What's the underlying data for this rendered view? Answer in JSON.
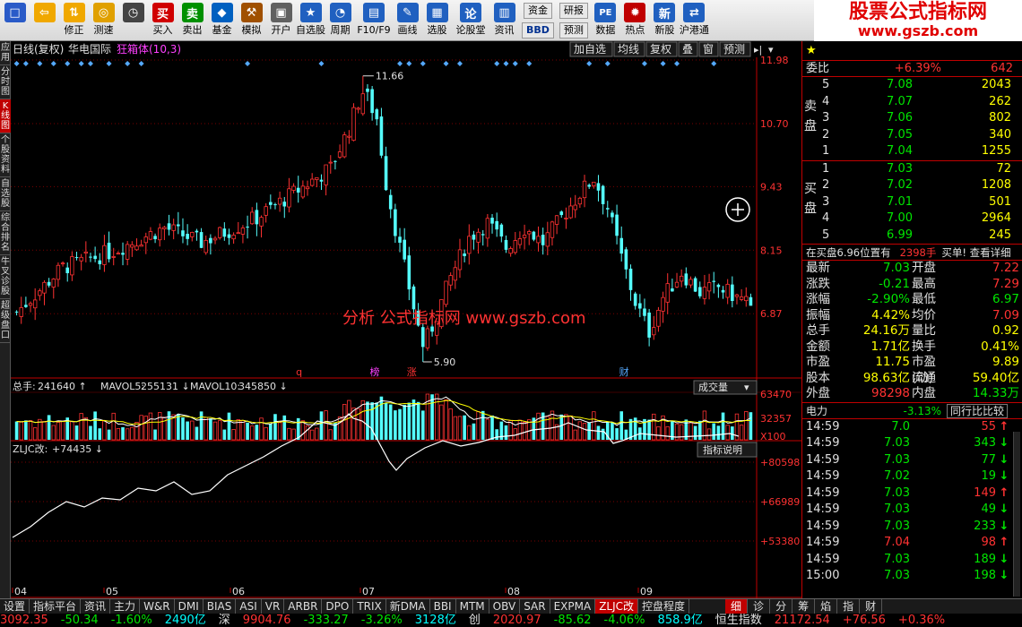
{
  "toolbar": {
    "items": [
      {
        "label": "",
        "icon": "app-logo-icon",
        "glyph": "□",
        "color": "#2a5bc8"
      },
      {
        "label": "",
        "icon": "back-arrow-icon",
        "glyph": "⇦",
        "color": "#f0a800"
      },
      {
        "label": "修正",
        "icon": "arrow-updown-icon",
        "glyph": "⇅",
        "color": "#f0a800"
      },
      {
        "label": "测速",
        "icon": "speed-icon",
        "glyph": "◎",
        "color": "#e0a000"
      },
      {
        "label": "",
        "icon": "clock-icon",
        "glyph": "◷",
        "color": "#444"
      },
      {
        "label": "买入",
        "icon": "buy-icon",
        "glyph": "买",
        "color": "#d00000"
      },
      {
        "label": "卖出",
        "icon": "sell-icon",
        "glyph": "卖",
        "color": "#009000"
      },
      {
        "label": "基金",
        "icon": "fund-icon",
        "glyph": "◆",
        "color": "#0060c0"
      },
      {
        "label": "模拟",
        "icon": "hammer-icon",
        "glyph": "⚒",
        "color": "#a05000"
      },
      {
        "label": "开户",
        "icon": "open-account-icon",
        "glyph": "▣",
        "color": "#606060"
      },
      {
        "label": "自选股",
        "icon": "favorites-icon",
        "glyph": "★",
        "color": "#2060c0"
      },
      {
        "label": "周期",
        "icon": "period-icon",
        "glyph": "◔",
        "color": "#2060c0"
      },
      {
        "label": "F10/F9",
        "icon": "f10-icon",
        "glyph": "▤",
        "color": "#2060c0"
      },
      {
        "label": "画线",
        "icon": "draw-line-icon",
        "glyph": "✎",
        "color": "#2060c0"
      },
      {
        "label": "选股",
        "icon": "select-stock-icon",
        "glyph": "▦",
        "color": "#2060c0"
      },
      {
        "label": "论股堂",
        "icon": "forum-icon",
        "glyph": "论",
        "color": "#2060c0"
      },
      {
        "label": "资讯",
        "icon": "news-icon",
        "glyph": "▥",
        "color": "#2060c0"
      }
    ],
    "stacked": {
      "top": "资金",
      "bottom": "BBD"
    },
    "stacked2": {
      "top": "研报",
      "bottom": "预测"
    },
    "items2": [
      {
        "label": "数据",
        "icon": "data-icon",
        "glyph": "PE",
        "color": "#2060c0"
      },
      {
        "label": "热点",
        "icon": "hot-icon",
        "glyph": "✹",
        "color": "#c00000"
      },
      {
        "label": "新股",
        "icon": "new-stock-icon",
        "glyph": "新",
        "color": "#2060c0"
      },
      {
        "label": "沪港通",
        "icon": "hk-connect-icon",
        "glyph": "⇄",
        "color": "#2060c0"
      }
    ],
    "brand_title": "股票公式指标网",
    "brand_url": "www.gszb.com"
  },
  "vtabs": [
    "应用",
    "分时图",
    "K线图",
    "个股资料",
    "自选股",
    "综合排名",
    "牛叉诊股",
    "超级盘口"
  ],
  "chart": {
    "title": "日线(复权)",
    "stock": "华电国际",
    "indicator": "狂箱体(10,3)",
    "buttons": [
      "加自选",
      "均线",
      "复权",
      "叠",
      "窗",
      "预测"
    ],
    "price_axis": [
      "11.98",
      "10.70",
      "9.43",
      "8.15",
      "6.87"
    ],
    "high_label": "11.66",
    "low_label": "5.90",
    "markers": [
      "q",
      "榜",
      "涨",
      "财"
    ],
    "watermark": "分析 公式指标网 www.gszb.com",
    "vol_header": {
      "name": "总手:",
      "value": "241640",
      "ma5_name": "MAVOL5:",
      "ma5": "255131",
      "ma10_name": "MAVOL10:",
      "ma10": "345850"
    },
    "vol_select": "成交量",
    "vol_axis": [
      "63470",
      "32357",
      "X100"
    ],
    "ind_header": {
      "name": "ZLJC改:",
      "value": "+74435"
    },
    "ind_button": "指标说明",
    "ind_axis": [
      "+80598",
      "+66989",
      "+53380"
    ],
    "x_axis": [
      "04",
      "05",
      "06",
      "07",
      "08",
      "09"
    ]
  },
  "chart_data": {
    "type": "candlestick",
    "x_range_labels": [
      "04",
      "05",
      "06",
      "07",
      "08",
      "09"
    ],
    "ylim_price": [
      5.9,
      11.98
    ],
    "price_high": 11.66,
    "price_low": 5.9,
    "last_close": 7.03,
    "volume": {
      "last": 241640,
      "mavol5": 255131,
      "mavol10": 345850,
      "axis_max": 63470,
      "unit": "X100"
    },
    "indicator_ZLJC": {
      "last": 74435,
      "axis": [
        80598,
        66989,
        53380
      ]
    }
  },
  "quote": {
    "wei_bi_label": "委比",
    "wei_bi": "+6.39%",
    "wei_cha": "642",
    "sell_label": "卖盘",
    "sells": [
      {
        "lvl": "5",
        "price": "7.08",
        "vol": "2043"
      },
      {
        "lvl": "4",
        "price": "7.07",
        "vol": "262"
      },
      {
        "lvl": "3",
        "price": "7.06",
        "vol": "802"
      },
      {
        "lvl": "2",
        "price": "7.05",
        "vol": "340"
      },
      {
        "lvl": "1",
        "price": "7.04",
        "vol": "1255"
      }
    ],
    "buy_label": "买盘",
    "buys": [
      {
        "lvl": "1",
        "price": "7.03",
        "vol": "72"
      },
      {
        "lvl": "2",
        "price": "7.02",
        "vol": "1208"
      },
      {
        "lvl": "3",
        "price": "7.01",
        "vol": "501"
      },
      {
        "lvl": "4",
        "price": "7.00",
        "vol": "2964"
      },
      {
        "lvl": "5",
        "price": "6.99",
        "vol": "245"
      }
    ],
    "notice": "在买盘6.96位置有",
    "notice_vol": "2398手",
    "notice_link": "买单! 查看详细",
    "rows": [
      [
        "最新",
        "7.03",
        "开盘",
        "7.22"
      ],
      [
        "涨跌",
        "-0.21",
        "最高",
        "7.29"
      ],
      [
        "涨幅",
        "-2.90%",
        "最低",
        "6.97"
      ],
      [
        "振幅",
        "4.42%",
        "均价",
        "7.09"
      ],
      [
        "总手",
        "24.16万",
        "量比",
        "0.92"
      ],
      [
        "金额",
        "1.71亿",
        "换手",
        "0.41%"
      ],
      [
        "市盈",
        "11.75",
        "市盈(动)",
        "9.89"
      ],
      [
        "股本",
        "98.63亿",
        "流通",
        "59.40亿"
      ],
      [
        "外盘",
        "98298",
        "内盘",
        "14.33万"
      ]
    ],
    "sector": "电力",
    "sector_pct": "-3.13%",
    "sector_button": "同行比比较",
    "ticks": [
      {
        "time": "14:59",
        "price": "7.0",
        "vol": "55",
        "dir": "up"
      },
      {
        "time": "14:59",
        "price": "7.03",
        "vol": "343",
        "dir": "down"
      },
      {
        "time": "14:59",
        "price": "7.03",
        "vol": "77",
        "dir": "down"
      },
      {
        "time": "14:59",
        "price": "7.02",
        "vol": "19",
        "dir": "down"
      },
      {
        "time": "14:59",
        "price": "7.03",
        "vol": "149",
        "dir": "up"
      },
      {
        "time": "14:59",
        "price": "7.03",
        "vol": "49",
        "dir": "down"
      },
      {
        "time": "14:59",
        "price": "7.03",
        "vol": "233",
        "dir": "down"
      },
      {
        "time": "14:59",
        "price": "7.04",
        "vol": "98",
        "dir": "up"
      },
      {
        "time": "14:59",
        "price": "7.03",
        "vol": "189",
        "dir": "down"
      },
      {
        "time": "15:00",
        "price": "7.03",
        "vol": "198",
        "dir": "down"
      }
    ]
  },
  "bottom_tabs": [
    "设置",
    "指标平台",
    "资讯",
    "主力",
    "W&R",
    "DMI",
    "BIAS",
    "ASI",
    "VR",
    "ARBR",
    "DPO",
    "TRIX",
    "新DMA",
    "BBI",
    "MTM",
    "OBV",
    "SAR",
    "EXPMA",
    "ZLJC改",
    "控盘程度"
  ],
  "right_bottom_tabs": [
    "细",
    "诊",
    "分",
    "筹",
    "焰",
    "指",
    "财"
  ],
  "status": [
    {
      "text": "3092.35",
      "c": "red"
    },
    {
      "text": "-50.34",
      "c": "green"
    },
    {
      "text": "-1.60%",
      "c": "green"
    },
    {
      "text": "2490亿",
      "c": "cyan"
    },
    {
      "text": "深",
      "c": "white"
    },
    {
      "text": "9904.76",
      "c": "red"
    },
    {
      "text": "-333.27",
      "c": "green"
    },
    {
      "text": "-3.26%",
      "c": "green"
    },
    {
      "text": "3128亿",
      "c": "cyan"
    },
    {
      "text": "创",
      "c": "white"
    },
    {
      "text": "2020.97",
      "c": "red"
    },
    {
      "text": "-85.62",
      "c": "green"
    },
    {
      "text": "-4.06%",
      "c": "green"
    },
    {
      "text": "858.9亿",
      "c": "cyan"
    },
    {
      "text": "恒生指数",
      "c": "white"
    },
    {
      "text": "21172.54",
      "c": "red"
    },
    {
      "text": "+76.56",
      "c": "red"
    },
    {
      "text": "+0.36%",
      "c": "red"
    }
  ],
  "colors": {
    "up": "#ff3232",
    "down": "#54fcfc",
    "grid": "#800000"
  }
}
